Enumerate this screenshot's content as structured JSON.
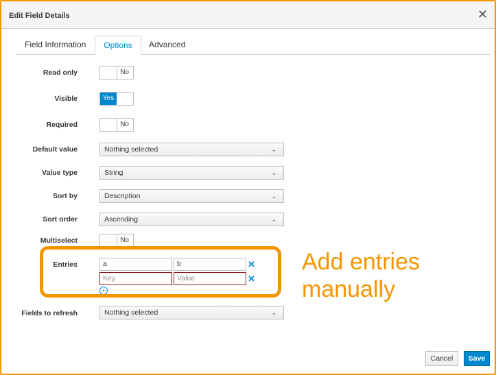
{
  "dialog": {
    "title": "Edit Field Details",
    "close_label": "✕"
  },
  "tabs": [
    {
      "label": "Field Information"
    },
    {
      "label": "Options",
      "active": true
    },
    {
      "label": "Advanced"
    }
  ],
  "form": {
    "read_only": {
      "label": "Read only",
      "value": "No"
    },
    "visible": {
      "label": "Visible",
      "value": "Yes"
    },
    "required": {
      "label": "Required",
      "value": "No"
    },
    "default_value": {
      "label": "Default value",
      "value": "Nothing selected"
    },
    "value_type": {
      "label": "Value type",
      "value": "String"
    },
    "sort_by": {
      "label": "Sort by",
      "value": "Description"
    },
    "sort_order": {
      "label": "Sort order",
      "value": "Ascending"
    },
    "multiselect": {
      "label": "Multiselect",
      "value": "No"
    },
    "entries": {
      "label": "Entries",
      "rows": [
        {
          "key": "a",
          "value": "b"
        }
      ],
      "new_row": {
        "key_placeholder": "Key",
        "value_placeholder": "Value"
      }
    },
    "fields_to_refresh": {
      "label": "Fields to refresh",
      "value": "Nothing selected"
    }
  },
  "annotation": {
    "line1": "Add entries",
    "line2": "manually",
    "color": "#f29600"
  },
  "footer": {
    "cancel_label": "Cancel",
    "save_label": "Save"
  },
  "colors": {
    "accent": "#0088ce",
    "highlight": "#f29600",
    "error_border": "#8b1a1a"
  }
}
